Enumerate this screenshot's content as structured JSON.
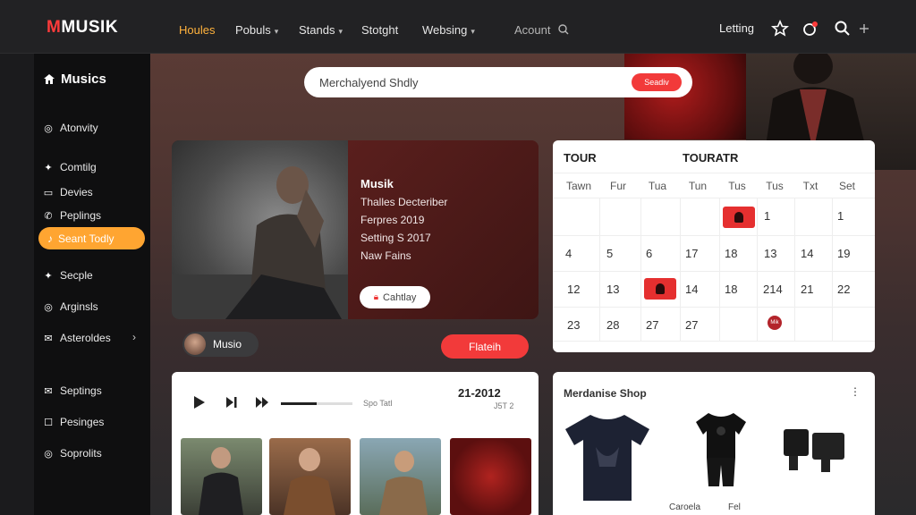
{
  "brand": {
    "logo_m": "M",
    "logo_rest": "MUSIK"
  },
  "nav": {
    "items": [
      {
        "label": "Houles",
        "active": true,
        "dropdown": false
      },
      {
        "label": "Pobuls",
        "active": false,
        "dropdown": true
      },
      {
        "label": "Stands",
        "active": false,
        "dropdown": true
      },
      {
        "label": "Stotght",
        "active": false,
        "dropdown": false
      },
      {
        "label": "Websing",
        "active": false,
        "dropdown": true
      }
    ],
    "account": "Acount",
    "letting": "Letting",
    "icons": [
      "search-icon",
      "star-icon",
      "notification-icon",
      "search-icon",
      "plus-icon"
    ]
  },
  "sidebar": {
    "title": "Musics",
    "items": [
      {
        "label": "Atonvity",
        "icon": "at-icon"
      },
      {
        "label": "Comtilg",
        "icon": "twitter-icon"
      },
      {
        "label": "Devies",
        "icon": "device-icon"
      },
      {
        "label": "Peplings",
        "icon": "phone-icon"
      },
      {
        "label": "Seant Todly",
        "icon": "music-icon",
        "active": true
      },
      {
        "label": "Secple",
        "icon": "twitter-icon"
      },
      {
        "label": "Arginsls",
        "icon": "at-icon"
      },
      {
        "label": "Asteroldes",
        "icon": "mail-icon",
        "chevron": true
      },
      {
        "label": "Septings",
        "icon": "mail-icon"
      },
      {
        "label": "Pesinges",
        "icon": "chat-icon"
      },
      {
        "label": "Soprolits",
        "icon": "at-icon"
      }
    ]
  },
  "search": {
    "value": "Merchalyend Shdly",
    "button": "Seadiv"
  },
  "artist": {
    "name": "Musik",
    "lines": [
      "Thalles Decteriber",
      "Ferpres 2019",
      "Setting S 2017",
      "Naw Fains"
    ],
    "button": "Cahtlay",
    "chip_label": "Musio",
    "cta": "Flateih"
  },
  "calendar": {
    "header_left": "TOUR",
    "header_right": "TOURATR",
    "days": [
      "Tawn",
      "Fur",
      "Tua",
      "Tun",
      "Tus",
      "Tus",
      "Txt",
      "Set"
    ],
    "weeks": [
      [
        "",
        "",
        "",
        "",
        "event",
        "1",
        "",
        "1"
      ],
      [
        "4",
        "5",
        "6",
        "17",
        "18",
        "13",
        "14",
        "19"
      ],
      [
        "12",
        "13",
        "event",
        "14",
        "18",
        "214",
        "21",
        "22"
      ],
      [
        "23",
        "28",
        "27",
        "27",
        "",
        "dot",
        "",
        ""
      ]
    ],
    "dot_label": "Mik"
  },
  "player": {
    "progress": 0.5,
    "info": "Spo Tatl",
    "date": "21-2012",
    "sub": "J5T 2"
  },
  "shop": {
    "title": "Merdanise Shop",
    "more": "⋮",
    "labels": [
      "Caroela",
      "Fel"
    ]
  }
}
